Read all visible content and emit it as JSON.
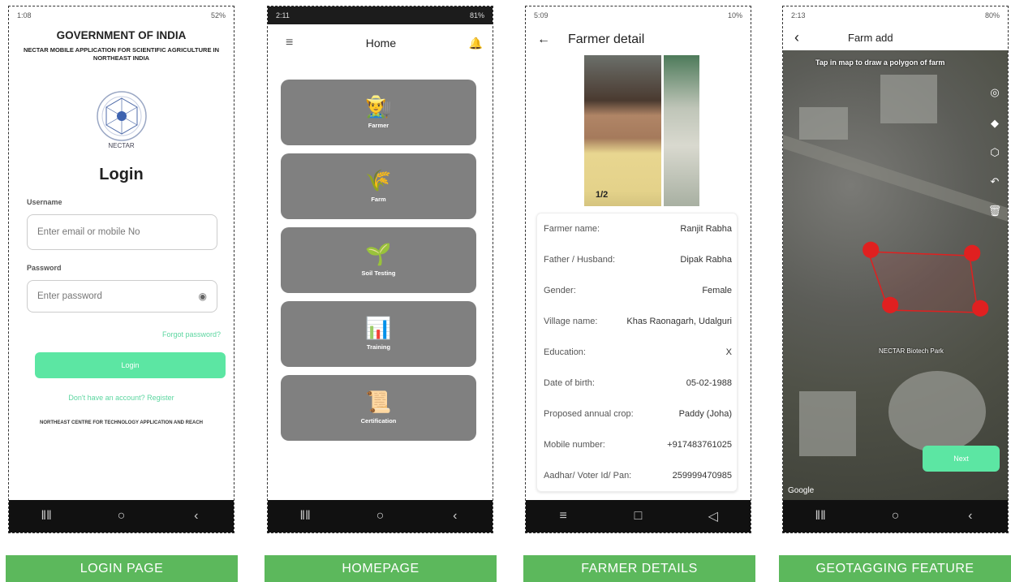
{
  "screens": {
    "login": {
      "status": {
        "time": "1:08",
        "battery": "52%"
      },
      "gov_title": "GOVERNMENT OF INDIA",
      "subtitle": "NECTAR MOBILE APPLICATION FOR SCIENTIFIC AGRICULTURE IN NORTHEAST INDIA",
      "logo_text": "NECTAR",
      "title": "Login",
      "username_label": "Username",
      "username_placeholder": "Enter email or mobile No",
      "password_label": "Password",
      "password_placeholder": "Enter password",
      "forgot": "Forgot password?",
      "login_button": "Login",
      "register": "Don't have an account? Register",
      "footer": "NORTHEAST CENTRE FOR TECHNOLOGY APPLICATION AND REACH"
    },
    "home": {
      "status": {
        "time": "2:11",
        "battery": "81%"
      },
      "title": "Home",
      "cards": [
        {
          "label": "Farmer",
          "icon": "farmer-icon"
        },
        {
          "label": "Farm",
          "icon": "farm-icon"
        },
        {
          "label": "Soil Testing",
          "icon": "soil-icon"
        },
        {
          "label": "Training",
          "icon": "training-icon"
        },
        {
          "label": "Certification",
          "icon": "certificate-icon"
        }
      ]
    },
    "farmer": {
      "status": {
        "time": "5:09",
        "battery": "10%"
      },
      "title": "Farmer detail",
      "photo_counter": "1/2",
      "rows": [
        {
          "label": "Farmer name:",
          "value": "Ranjit Rabha"
        },
        {
          "label": "Father / Husband:",
          "value": "Dipak Rabha"
        },
        {
          "label": "Gender:",
          "value": "Female"
        },
        {
          "label": "Village name:",
          "value": "Khas Raonagarh, Udalguri"
        },
        {
          "label": "Education:",
          "value": "X"
        },
        {
          "label": "Date of birth:",
          "value": "05-02-1988"
        },
        {
          "label": "Proposed annual crop:",
          "value": "Paddy (Joha)"
        },
        {
          "label": "Mobile number:",
          "value": "+917483761025"
        },
        {
          "label": "Aadhar/ Voter Id/ Pan:",
          "value": "259999470985"
        }
      ]
    },
    "map": {
      "status": {
        "time": "2:13",
        "battery": "80%"
      },
      "title": "Farm add",
      "hint": "Tap in map to draw a polygon of farm",
      "place": "NECTAR Biotech Park",
      "next_button": "Next",
      "attribution": "Google"
    }
  },
  "captions": [
    "LOGIN PAGE",
    "HOMEPAGE",
    "FARMER DETAILS",
    "GEOTAGGING FEATURE"
  ],
  "colors": {
    "accent_green": "#5ce6a3",
    "caption_green": "#5cb85c",
    "card_gray": "#808080"
  }
}
